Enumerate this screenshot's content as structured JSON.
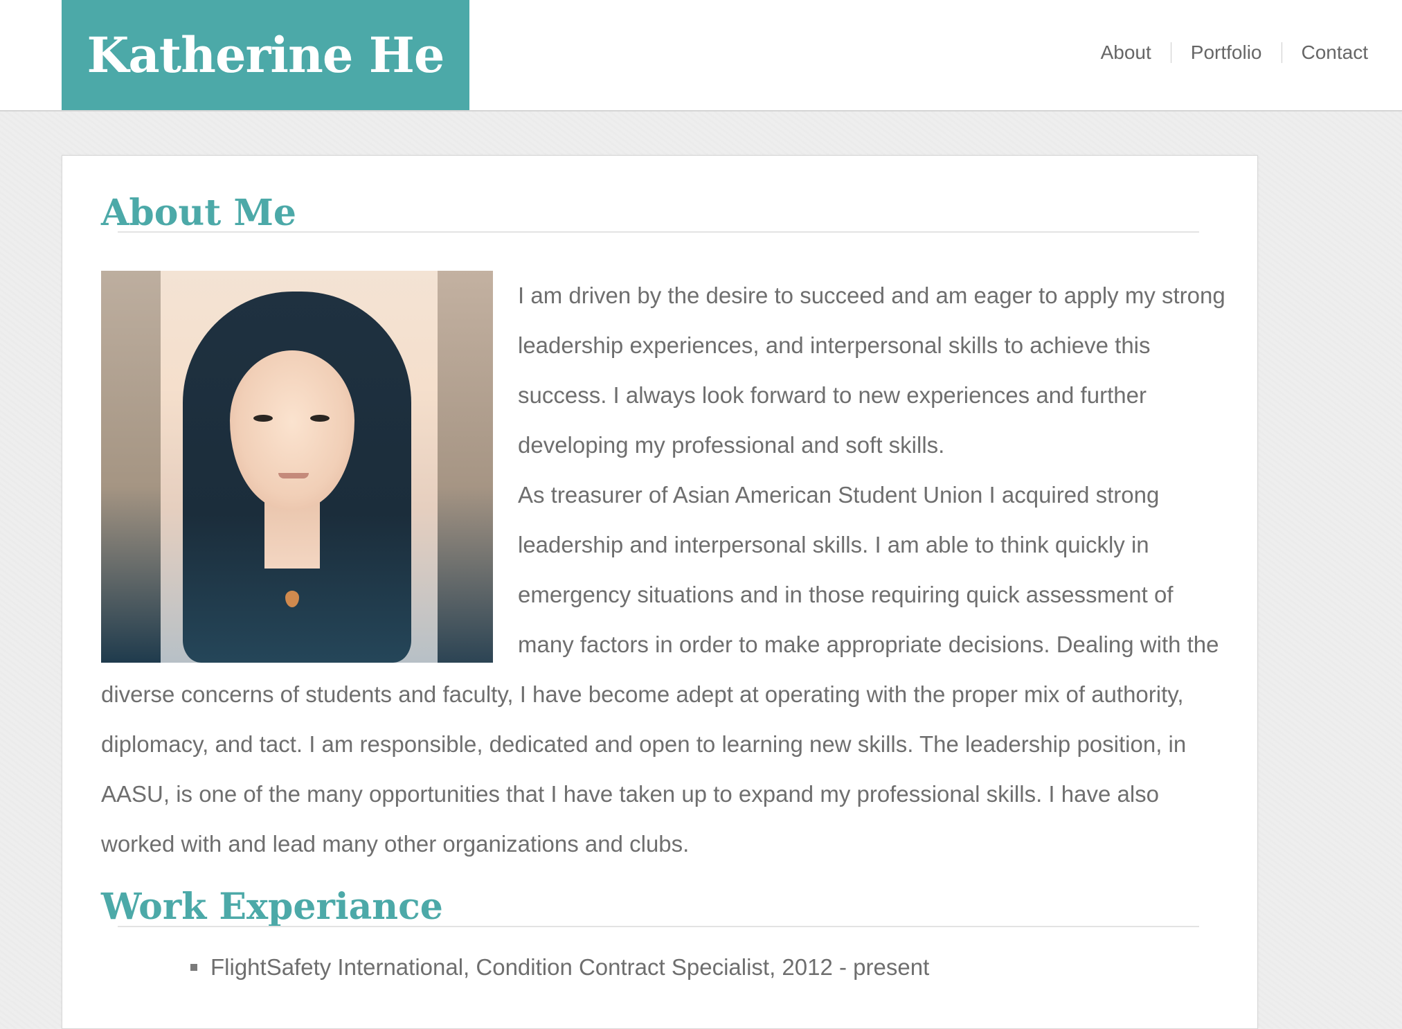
{
  "header": {
    "site_title": "Katherine He",
    "nav": [
      {
        "label": "About"
      },
      {
        "label": "Portfolio"
      },
      {
        "label": "Contact"
      }
    ]
  },
  "about": {
    "heading": "About Me",
    "paragraph_1": "I am driven by the desire to succeed and am eager to apply my strong leadership experiences, and interpersonal skills to achieve this success. I always look forward to new experiences and further developing my professional and soft skills.",
    "paragraph_2": "As treasurer of Asian American Student Union I acquired strong leadership and interpersonal skills. I am able to think quickly in emergency situations and in those requiring quick assessment of many factors in order to make appropriate decisions. Dealing with the diverse concerns of students and faculty, I have become adept at operating with the proper mix of authority, diplomacy, and tact. I am responsible, dedicated and open to learning new skills. The leadership position, in AASU, is one of the many opportunities that I have taken up to expand my professional skills. I have also worked with and lead many other organizations and clubs."
  },
  "work": {
    "heading": "Work Experiance",
    "items": [
      {
        "text": "FlightSafety International, Condition Contract Specialist, 2012 - present"
      }
    ]
  },
  "colors": {
    "accent": "#4ca9a8",
    "text": "#6e6e6e",
    "nav_text": "#666666"
  }
}
